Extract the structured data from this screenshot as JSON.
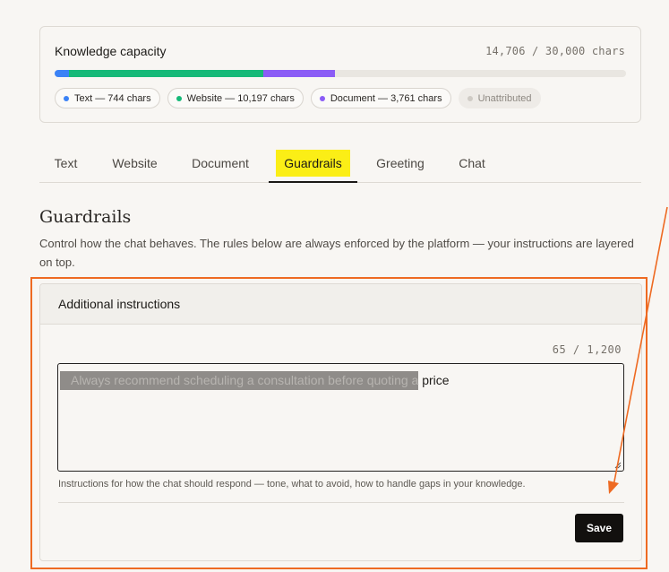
{
  "knowledge": {
    "title": "Knowledge capacity",
    "count": "14,706 / 30,000 chars",
    "used": 14706,
    "max": 30000,
    "segments": [
      {
        "name": "text",
        "value": 744,
        "color": "#3b82f6"
      },
      {
        "name": "website",
        "value": 10197,
        "color": "#16b978"
      },
      {
        "name": "document",
        "value": 3761,
        "color": "#8b5cf6"
      }
    ],
    "pills": [
      {
        "label": "Text — 744 chars",
        "color": "#3b82f6"
      },
      {
        "label": "Website — 10,197 chars",
        "color": "#16b978"
      },
      {
        "label": "Document — 3,761 chars",
        "color": "#8b5cf6"
      },
      {
        "label": "Unattributed",
        "color": "#cfcbc5"
      }
    ]
  },
  "tabs": [
    {
      "label": "Text"
    },
    {
      "label": "Website"
    },
    {
      "label": "Document"
    },
    {
      "label": "Guardrails",
      "active": true
    },
    {
      "label": "Greeting"
    },
    {
      "label": "Chat"
    }
  ],
  "section": {
    "title": "Guardrails",
    "description": "Control how the chat behaves. The rules below are always enforced by the platform — your instructions are layered on top."
  },
  "instructions": {
    "heading": "Additional instructions",
    "counter": "65 / 1,200",
    "selected_text": "Always recommend scheduling a consultation before quoting a",
    "rest_text": " price",
    "help": "Instructions for how the chat should respond — tone, what to avoid, how to handle gaps in your knowledge.",
    "save_label": "Save"
  },
  "colors": {
    "accent_highlight": "#fbee16",
    "annotation": "#ee6a22",
    "primary_button": "#12100e"
  }
}
